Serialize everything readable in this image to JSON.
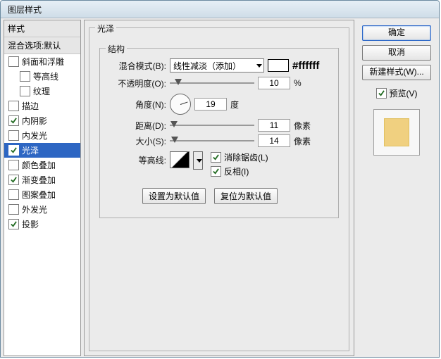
{
  "window": {
    "title": "图层样式"
  },
  "sidebar": {
    "head": "样式",
    "subhead": "混合选项:默认",
    "items": [
      {
        "label": "斜面和浮雕",
        "checked": false,
        "sub": false
      },
      {
        "label": "等高线",
        "checked": false,
        "sub": true
      },
      {
        "label": "纹理",
        "checked": false,
        "sub": true
      },
      {
        "label": "描边",
        "checked": false,
        "sub": false
      },
      {
        "label": "内阴影",
        "checked": true,
        "sub": false
      },
      {
        "label": "内发光",
        "checked": false,
        "sub": false
      },
      {
        "label": "光泽",
        "checked": true,
        "sub": false,
        "selected": true
      },
      {
        "label": "颜色叠加",
        "checked": false,
        "sub": false
      },
      {
        "label": "渐变叠加",
        "checked": true,
        "sub": false
      },
      {
        "label": "图案叠加",
        "checked": false,
        "sub": false
      },
      {
        "label": "外发光",
        "checked": false,
        "sub": false
      },
      {
        "label": "投影",
        "checked": true,
        "sub": false
      }
    ]
  },
  "main": {
    "group_title": "光泽",
    "struct_title": "结构",
    "blend_label": "混合模式(B):",
    "blend_value": "线性减淡（添加）",
    "color_hex": "#ffffff",
    "opacity_label": "不透明度(O):",
    "opacity_val": "10",
    "opacity_unit": "%",
    "angle_label": "角度(N):",
    "angle_val": "19",
    "angle_unit": "度",
    "distance_label": "距离(D):",
    "distance_val": "11",
    "distance_unit": "像素",
    "size_label": "大小(S):",
    "size_val": "14",
    "size_unit": "像素",
    "contour_label": "等高线:",
    "antialias_label": "消除锯齿(L)",
    "antialias_checked": true,
    "invert_label": "反相(I)",
    "invert_checked": true,
    "btn_default": "设置为默认值",
    "btn_reset": "复位为默认值"
  },
  "right": {
    "ok": "确定",
    "cancel": "取消",
    "newstyle": "新建样式(W)...",
    "preview_label": "预览(V)",
    "preview_checked": true
  }
}
